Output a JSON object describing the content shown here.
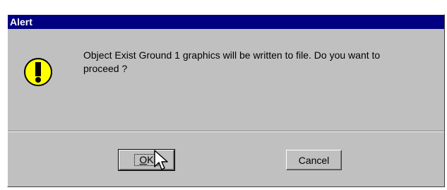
{
  "dialog": {
    "title": "Alert",
    "icon": "exclamation-warning-icon",
    "message": "Object Exist Ground 1 graphics will be written to file. Do you want to proceed ?",
    "buttons": {
      "ok": {
        "mnemonic": "O",
        "rest": "K"
      },
      "cancel": "Cancel"
    }
  },
  "colors": {
    "titlebar": "#000080",
    "dialog_face": "#c0c0c0",
    "icon_fill": "#ffff00"
  }
}
